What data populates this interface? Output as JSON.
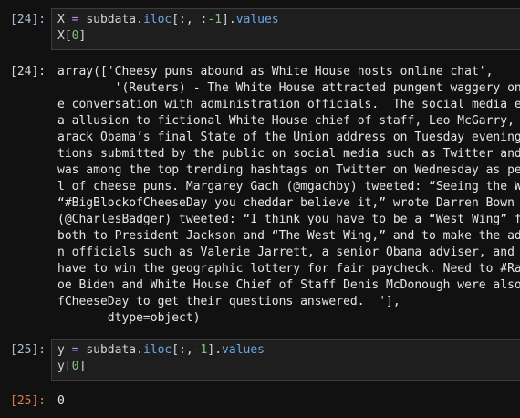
{
  "cells": [
    {
      "in_prompt": "[24]:",
      "code": {
        "line1": {
          "var": "X",
          "op": "=",
          "obj": "subdata.",
          "method": "iloc",
          "open": "[:, :",
          "neg": "-1",
          "close": "].",
          "attr": "values"
        },
        "line2": {
          "var": "X",
          "open": "[",
          "idx": "0",
          "close": "]"
        }
      },
      "out_prompt": "[24]:",
      "output_lines": [
        "array(['Cheesy puns abound as White House hosts online chat',",
        "        '(Reuters) - The White House attracted pungent waggery on",
        "e conversation with administration officials.  The social media e",
        "a allusion to fictional White House chief of staff, Leo McGarry,",
        "arack Obama’s final State of the Union address on Tuesday evening",
        "tions submitted by the public on social media such as Twitter and",
        "was among the top trending hashtags on Twitter on Wednesday as pe",
        "l of cheese puns. Margarey Gach (@mgachby) tweeted: “Seeing the W",
        "“#BigBlockofCheeseDay you cheddar believe it,” wrote Darren Bown",
        "(@CharlesBadger) tweeted: “I think you have to be a “West Wing” f",
        "both to President Jackson and “The West Wing,” and to make the ad",
        "n officials such as Valerie Jarrett, a senior Obama adviser, and",
        "have to win the geographic lottery for fair paycheck. Need to #Ra",
        "oe Biden and White House Chief of Staff Denis McDonough were also",
        "fCheeseDay to get their questions answered.  '],",
        "       dtype=object)"
      ]
    },
    {
      "in_prompt": "[25]:",
      "code": {
        "line1": {
          "var": "y",
          "op": "=",
          "obj": "subdata.",
          "method": "iloc",
          "open": "[:,",
          "neg": "-1",
          "close": "].",
          "attr": "values"
        },
        "line2": {
          "var": "y",
          "open": "[",
          "idx": "0",
          "close": "]"
        }
      },
      "out_prompt": "[25]:",
      "output_lines": [
        "0"
      ]
    }
  ]
}
